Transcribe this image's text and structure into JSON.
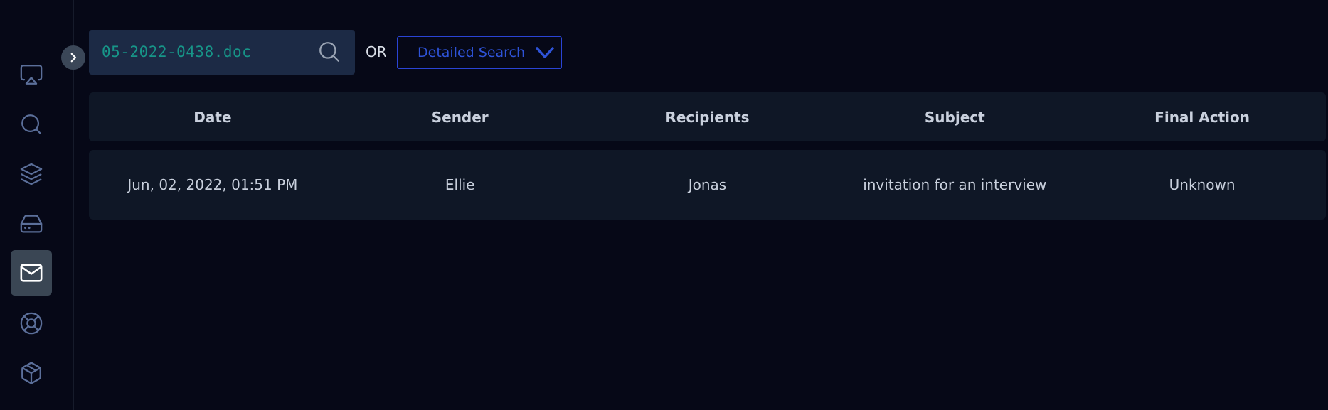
{
  "sidebar": {
    "items": [
      {
        "icon": "airplay-icon",
        "active": false
      },
      {
        "icon": "search-icon",
        "active": false
      },
      {
        "icon": "layers-icon",
        "active": false
      },
      {
        "icon": "hard-drive-icon",
        "active": false
      },
      {
        "icon": "mail-icon",
        "active": true
      },
      {
        "icon": "lifebuoy-icon",
        "active": false
      },
      {
        "icon": "package-icon",
        "active": false
      }
    ],
    "toggle_icon": "chevron-right-icon"
  },
  "search": {
    "value": "05-2022-0438.doc",
    "icon": "search-icon"
  },
  "or_label": "OR",
  "detailed_search": {
    "label": "Detailed Search",
    "icon": "chevron-down-icon"
  },
  "table": {
    "columns": [
      "Date",
      "Sender",
      "Recipients",
      "Subject",
      "Final Action"
    ],
    "rows": [
      [
        "Jun, 02, 2022, 01:51 PM",
        "Ellie",
        "Jonas",
        "invitation for an interview",
        "Unknown"
      ]
    ]
  },
  "colors": {
    "background": "#060817",
    "accent": "#2e53d8",
    "search_text": "#179588",
    "active_nav": "#3a4654"
  }
}
